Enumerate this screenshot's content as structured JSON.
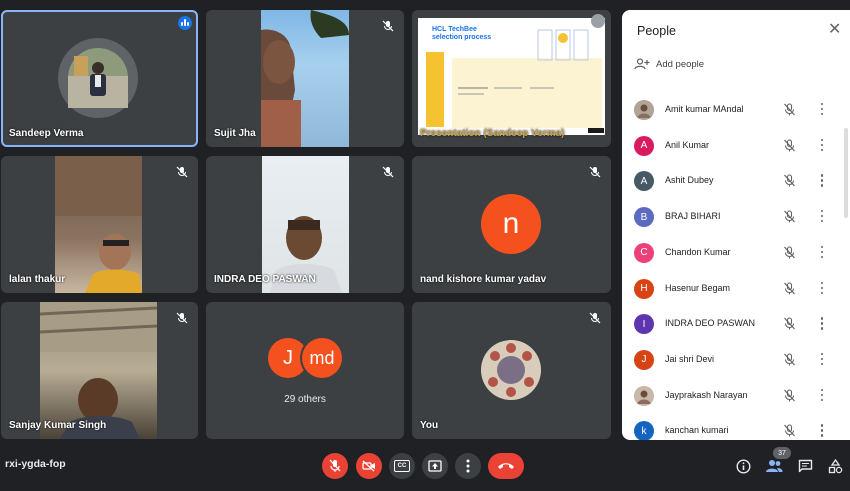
{
  "meeting": {
    "code": "rxi-ygda-fop"
  },
  "tiles": {
    "sandeep": {
      "name": "Sandeep Verma"
    },
    "sujit": {
      "name": "Sujit Jha"
    },
    "presentation": {
      "name": "Presentation (Sandeep Verma)",
      "slide_title": "HCL TechBee\nselection process"
    },
    "lalan": {
      "name": "lalan thakur"
    },
    "indra": {
      "name": "INDRA DEO PASWAN"
    },
    "nand": {
      "name": "nand kishore kumar yadav",
      "initial": "n",
      "color": "#f4511e"
    },
    "sanjay": {
      "name": "Sanjay Kumar Singh"
    },
    "others": {
      "initial_1": "J",
      "initial_2": "md",
      "label": "29 others",
      "color_1": "#f4511e",
      "color_2": "#f4511e"
    },
    "you": {
      "name": "You"
    }
  },
  "people_panel": {
    "title": "People",
    "add_people": "Add people",
    "participants": [
      {
        "name": "Amit kumar MAndal",
        "initial": "",
        "color": "#b0a596",
        "photo": true
      },
      {
        "name": "Anil Kumar",
        "initial": "A",
        "color": "#d81b60",
        "photo": false
      },
      {
        "name": "Ashit Dubey",
        "initial": "A",
        "color": "#455a64",
        "photo": false
      },
      {
        "name": "BRAJ BIHARI",
        "initial": "B",
        "color": "#5c6bc0",
        "photo": false
      },
      {
        "name": "Chandon Kumar",
        "initial": "C",
        "color": "#ec407a",
        "photo": false
      },
      {
        "name": "Hasenur Begam",
        "initial": "H",
        "color": "#d84315",
        "photo": false
      },
      {
        "name": "INDRA DEO PASWAN",
        "initial": "I",
        "color": "#5e35b1",
        "photo": false
      },
      {
        "name": "Jai shri Devi",
        "initial": "J",
        "color": "#d84315",
        "photo": false
      },
      {
        "name": "Jayprakash Narayan",
        "initial": "",
        "color": "#c9b8a8",
        "photo": true
      },
      {
        "name": "kanchan kumari",
        "initial": "k",
        "color": "#1565c0",
        "photo": false
      }
    ]
  },
  "toolbar": {
    "participant_count": "37",
    "end_color": "#ea4335",
    "cc_label": "CC"
  },
  "colors": {
    "accent": "#8ab4f8",
    "tile_bg": "#3c4043",
    "page_bg": "#202124",
    "danger": "#ea4335"
  }
}
